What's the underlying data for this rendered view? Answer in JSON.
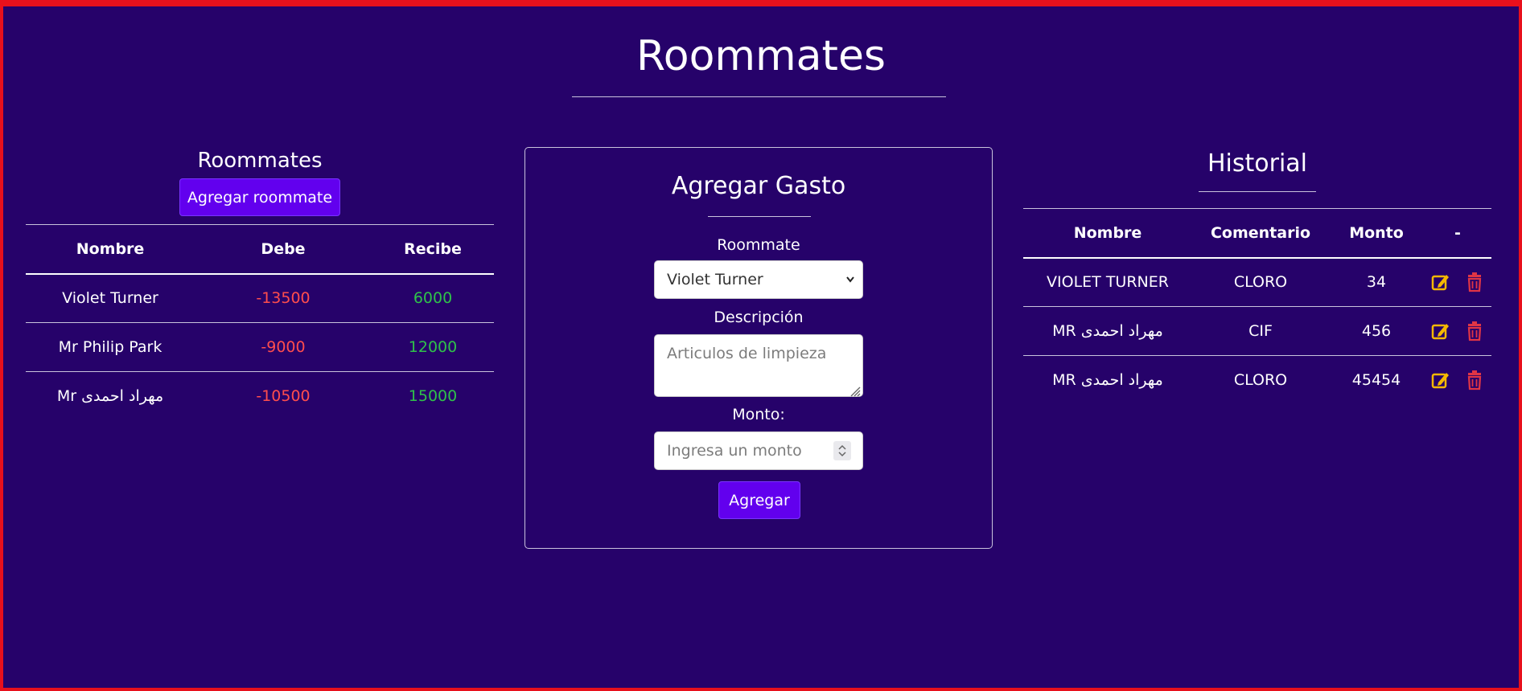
{
  "page": {
    "title": "Roommates"
  },
  "roommates": {
    "heading": "Roommates",
    "add_button": "Agregar roommate",
    "columns": [
      "Nombre",
      "Debe",
      "Recibe"
    ],
    "rows": [
      {
        "nombre": "Violet Turner",
        "debe": "-13500",
        "recibe": "6000"
      },
      {
        "nombre": "Mr Philip Park",
        "debe": "-9000",
        "recibe": "12000"
      },
      {
        "nombre": "Mr مهراد احمدی",
        "debe": "-10500",
        "recibe": "15000"
      }
    ]
  },
  "form": {
    "title": "Agregar Gasto",
    "roommate_label": "Roommate",
    "roommate_selected": "Violet Turner",
    "descripcion_label": "Descripción",
    "descripcion_placeholder": "Articulos de limpieza",
    "monto_label": "Monto:",
    "monto_placeholder": "Ingresa un monto",
    "submit_label": "Agregar"
  },
  "historial": {
    "heading": "Historial",
    "columns": [
      "Nombre",
      "Comentario",
      "Monto",
      "-"
    ],
    "rows": [
      {
        "nombre": "VIOLET TURNER",
        "comentario": "CLORO",
        "monto": "34"
      },
      {
        "nombre": "MR مهراد احمدی",
        "comentario": "CIF",
        "monto": "456"
      },
      {
        "nombre": "MR مهراد احمدی",
        "comentario": "CLORO",
        "monto": "45454"
      }
    ],
    "action_icons": [
      "edit-icon",
      "trash-icon"
    ]
  },
  "colors": {
    "background": "#26026a",
    "button": "#6200ee",
    "negative": "#ff4d4d",
    "positive": "#2fc24a",
    "edit_icon": "#f6b800",
    "delete_icon": "#e03545",
    "frame": "#e8101c"
  }
}
